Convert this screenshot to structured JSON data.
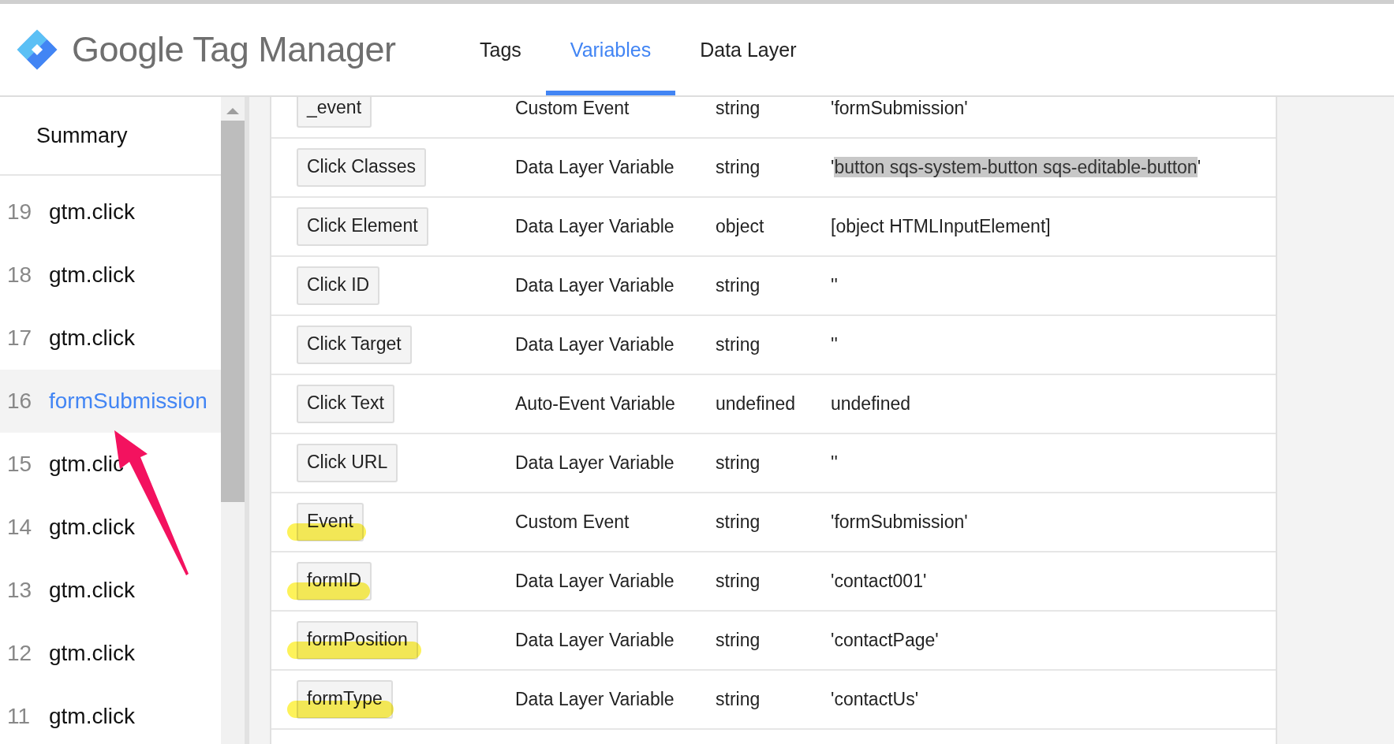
{
  "header": {
    "product": "Google Tag Manager",
    "tabs": [
      {
        "label": "Tags",
        "selected": false
      },
      {
        "label": "Variables",
        "selected": true
      },
      {
        "label": "Data Layer",
        "selected": false
      }
    ]
  },
  "sidebar": {
    "summary": "Summary",
    "events": [
      {
        "number": "19",
        "name": "gtm.click",
        "selected": false
      },
      {
        "number": "18",
        "name": "gtm.click",
        "selected": false
      },
      {
        "number": "17",
        "name": "gtm.click",
        "selected": false
      },
      {
        "number": "16",
        "name": "formSubmission",
        "selected": true
      },
      {
        "number": "15",
        "name": "gtm.clic",
        "selected": false
      },
      {
        "number": "14",
        "name": "gtm.click",
        "selected": false
      },
      {
        "number": "13",
        "name": "gtm.click",
        "selected": false
      },
      {
        "number": "12",
        "name": "gtm.click",
        "selected": false
      },
      {
        "number": "11",
        "name": "gtm.click",
        "selected": false
      }
    ]
  },
  "variables": [
    {
      "name": "_event",
      "type": "Custom Event",
      "data_type": "string",
      "value": "'formSubmission'",
      "highlighted": false
    },
    {
      "name": "Click Classes",
      "type": "Data Layer Variable",
      "data_type": "string",
      "value_parts": [
        {
          "text": "'",
          "selected": false
        },
        {
          "text": "button sqs-system-button sqs-editable-button",
          "selected": true
        },
        {
          "text": "'",
          "selected": false
        }
      ],
      "highlighted": false
    },
    {
      "name": "Click Element",
      "type": "Data Layer Variable",
      "data_type": "object",
      "value": "[object HTMLInputElement]",
      "highlighted": false
    },
    {
      "name": "Click ID",
      "type": "Data Layer Variable",
      "data_type": "string",
      "value": "''",
      "highlighted": false
    },
    {
      "name": "Click Target",
      "type": "Data Layer Variable",
      "data_type": "string",
      "value": "''",
      "highlighted": false
    },
    {
      "name": "Click Text",
      "type": "Auto-Event Variable",
      "data_type": "undefined",
      "value": "undefined",
      "highlighted": false
    },
    {
      "name": "Click URL",
      "type": "Data Layer Variable",
      "data_type": "string",
      "value": "''",
      "highlighted": false
    },
    {
      "name": "Event",
      "type": "Custom Event",
      "data_type": "string",
      "value": "'formSubmission'",
      "highlighted": true
    },
    {
      "name": "formID",
      "type": "Data Layer Variable",
      "data_type": "string",
      "value": "'contact001'",
      "highlighted": true
    },
    {
      "name": "formPosition",
      "type": "Data Layer Variable",
      "data_type": "string",
      "value": "'contactPage'",
      "highlighted": true
    },
    {
      "name": "formType",
      "type": "Data Layer Variable",
      "data_type": "string",
      "value": "'contactUs'",
      "highlighted": true
    }
  ]
}
